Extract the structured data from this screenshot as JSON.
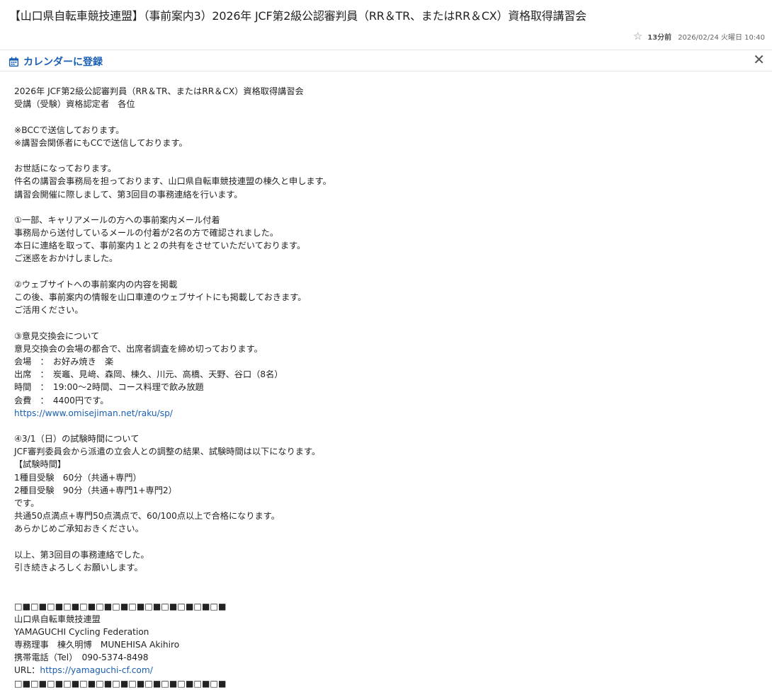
{
  "header": {
    "subject": "【山口県自転車競技連盟】（事前案内3）2026年 JCF第2級公認審判員（RR＆TR、またはRR＆CX）資格取得講習会",
    "star_icon": "star-icon",
    "time_ago": "13分前",
    "datetime": "2026/02/24 火曜日 10:40"
  },
  "toolbar": {
    "calendar_label": "カレンダーに登録",
    "calendar_icon": "calendar-icon",
    "close_icon": "close-icon",
    "accent_color": "#1a5fb4"
  },
  "body": {
    "lines": [
      {
        "text": "2026年 JCF第2級公認審判員（RR＆TR、またはRR＆CX）資格取得講習会"
      },
      {
        "text": "受講（受験）資格認定者　各位"
      },
      {
        "text": ""
      },
      {
        "text": "※BCCで送信しております。"
      },
      {
        "text": "※講習会関係者にもCCで送信しております。"
      },
      {
        "text": ""
      },
      {
        "text": "お世話になっております。"
      },
      {
        "text": "件名の講習会事務局を担っております、山口県自転車競技連盟の棟久と申します。"
      },
      {
        "text": "講習会開催に際しまして、第3回目の事務連絡を行います。"
      },
      {
        "text": ""
      },
      {
        "text": "①一部、キャリアメールの方への事前案内メール付着"
      },
      {
        "text": "事務局から送付しているメールの付着が2名の方で確認されました。"
      },
      {
        "text": "本日に連絡を取って、事前案内１と２の共有をさせていただいております。"
      },
      {
        "text": "ご迷惑をおかけしました。"
      },
      {
        "text": ""
      },
      {
        "text": "②ウェブサイトへの事前案内の内容を掲載"
      },
      {
        "text": "この後、事前案内の情報を山口車連のウェブサイトにも掲載しておきます。"
      },
      {
        "text": "ご活用ください。"
      },
      {
        "text": ""
      },
      {
        "text": "③意見交換会について"
      },
      {
        "text": "意見交換会の会場の都合で、出席者調査を締め切っております。"
      },
      {
        "text": "会場　：　お好み焼き　楽"
      },
      {
        "text": "出席　：　炭竈、見﨑、森岡、棟久、川元、高橋、天野、谷口（8名）"
      },
      {
        "text": "時間　：　19:00～2時間、コース料理で飲み放題"
      },
      {
        "text": "会費　：　4400円です。"
      },
      {
        "link": "https://www.omisejiman.net/raku/sp/"
      },
      {
        "text": ""
      },
      {
        "text": "④3/1（日）の試験時間について"
      },
      {
        "text": "JCF審判委員会から派遣の立会人との調整の結果、試験時間は以下になります。"
      },
      {
        "text": "【試験時間】"
      },
      {
        "text": "1種目受験　60分（共通+専門）"
      },
      {
        "text": "2種目受験　90分（共通+専門1+専門2）"
      },
      {
        "text": "です。"
      },
      {
        "text": "共通50点満点+専門50点満点で、60/100点以上で合格になります。"
      },
      {
        "text": "あらかじめご承知おきください。"
      },
      {
        "text": ""
      },
      {
        "text": "以上、第3回目の事務連絡でした。"
      },
      {
        "text": "引き続きよろしくお願いします。"
      },
      {
        "text": ""
      },
      {
        "text": ""
      },
      {
        "text": "□■□■□■□■□■□■□■□■□■□■□■□■□■"
      },
      {
        "text": "山口県自転車競技連盟"
      },
      {
        "text": "YAMAGUCHI Cycling Federation"
      },
      {
        "text": "専務理事　棟久明博　MUNEHISA Akihiro"
      },
      {
        "text": "携帯電話（Tel）　090-5374-8498"
      },
      {
        "text": "URL：",
        "link": "https://yamaguchi-cf.com/"
      },
      {
        "text": "□■□■□■□■□■□■□■□■□■□■□■□■□■"
      }
    ]
  }
}
